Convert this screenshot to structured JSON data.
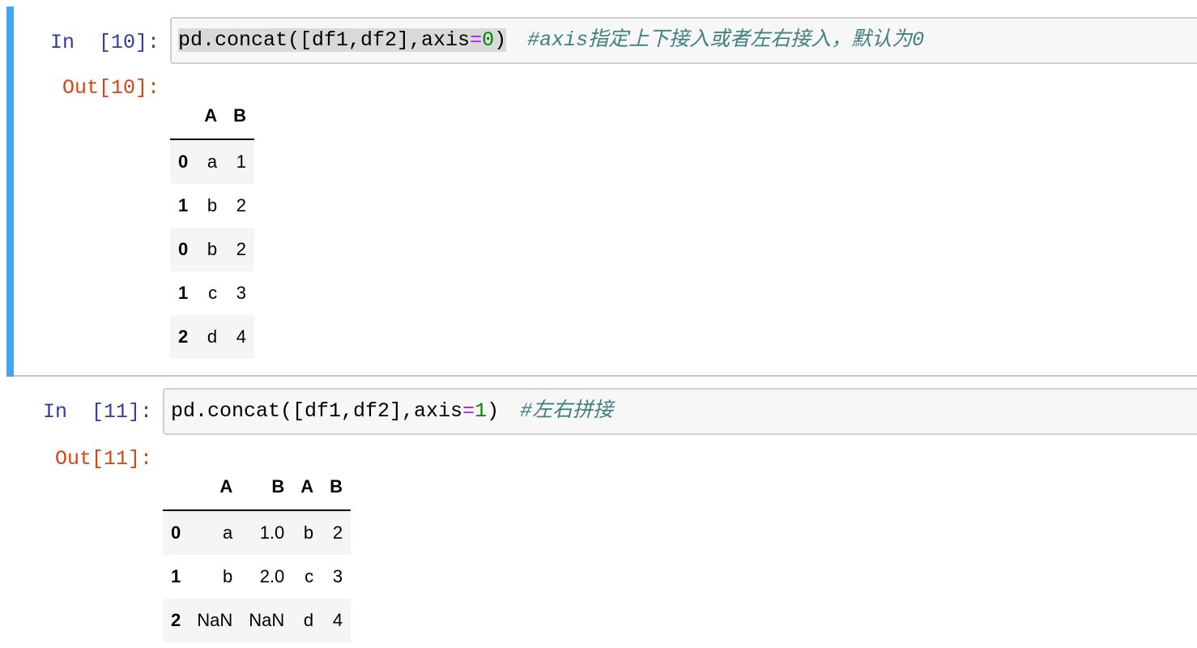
{
  "cells": [
    {
      "in_prompt": "In  [10]:",
      "code": {
        "prefix": "pd.concat([df1,df2],axis",
        "op": "=",
        "num": "0",
        "suffix": ")"
      },
      "comment": "#axis指定上下接入或者左右接入，默认为0",
      "out_prompt": "Out[10]:",
      "table": {
        "columns": [
          "",
          "A",
          "B"
        ],
        "rows": [
          {
            "index": "0",
            "values": [
              "a",
              "1"
            ]
          },
          {
            "index": "1",
            "values": [
              "b",
              "2"
            ]
          },
          {
            "index": "0",
            "values": [
              "b",
              "2"
            ]
          },
          {
            "index": "1",
            "values": [
              "c",
              "3"
            ]
          },
          {
            "index": "2",
            "values": [
              "d",
              "4"
            ]
          }
        ]
      }
    },
    {
      "in_prompt": "In  [11]:",
      "code": {
        "prefix": "pd.concat([df1,df2],axis",
        "op": "=",
        "num": "1",
        "suffix": ")"
      },
      "comment": "#左右拼接",
      "out_prompt": "Out[11]:",
      "table": {
        "columns": [
          "",
          "A",
          "B",
          "A",
          "B"
        ],
        "rows": [
          {
            "index": "0",
            "values": [
              "a",
              "1.0",
              "b",
              "2"
            ]
          },
          {
            "index": "1",
            "values": [
              "b",
              "2.0",
              "c",
              "3"
            ]
          },
          {
            "index": "2",
            "values": [
              "NaN",
              "NaN",
              "d",
              "4"
            ]
          }
        ]
      }
    }
  ],
  "colors": {
    "selected_cell_bar": "#42a5f5",
    "in_prompt": "#303f9f",
    "out_prompt": "#d84315",
    "comment": "#408080"
  }
}
